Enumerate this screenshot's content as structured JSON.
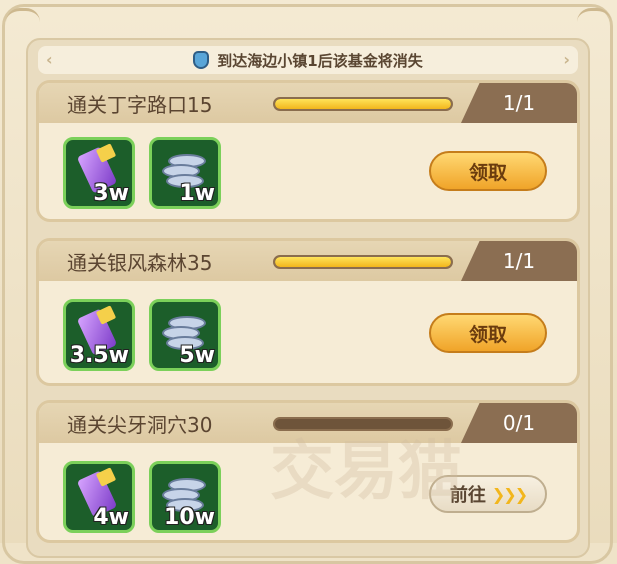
{
  "notice": {
    "text": "到达海边小镇1后该基金将消失",
    "icon": "hourglass-icon"
  },
  "tasks": [
    {
      "title": "通关丁字路口15",
      "count": "1/1",
      "progress": 1.0,
      "rewards": [
        {
          "icon": "purple-crystal-icon",
          "qty": "3w"
        },
        {
          "icon": "silver-coins-icon",
          "qty": "1w"
        }
      ],
      "action": "领取"
    },
    {
      "title": "通关银风森林35",
      "count": "1/1",
      "progress": 1.0,
      "rewards": [
        {
          "icon": "purple-crystal-icon",
          "qty": "3.5w"
        },
        {
          "icon": "silver-coins-icon",
          "qty": "5w"
        }
      ],
      "action": "领取"
    },
    {
      "title": "通关尖牙洞穴30",
      "count": "0/1",
      "progress": 0.0,
      "rewards": [
        {
          "icon": "purple-crystal-icon",
          "qty": "4w"
        },
        {
          "icon": "silver-coins-icon",
          "qty": "10w"
        }
      ],
      "action": "前往",
      "action_arrows": "❯❯❯"
    }
  ],
  "watermark": "交易猫",
  "colors": {
    "accent_gold": "#f2b61c",
    "reward_border": "#7bd05a",
    "tab_brown": "#8b6e52"
  }
}
